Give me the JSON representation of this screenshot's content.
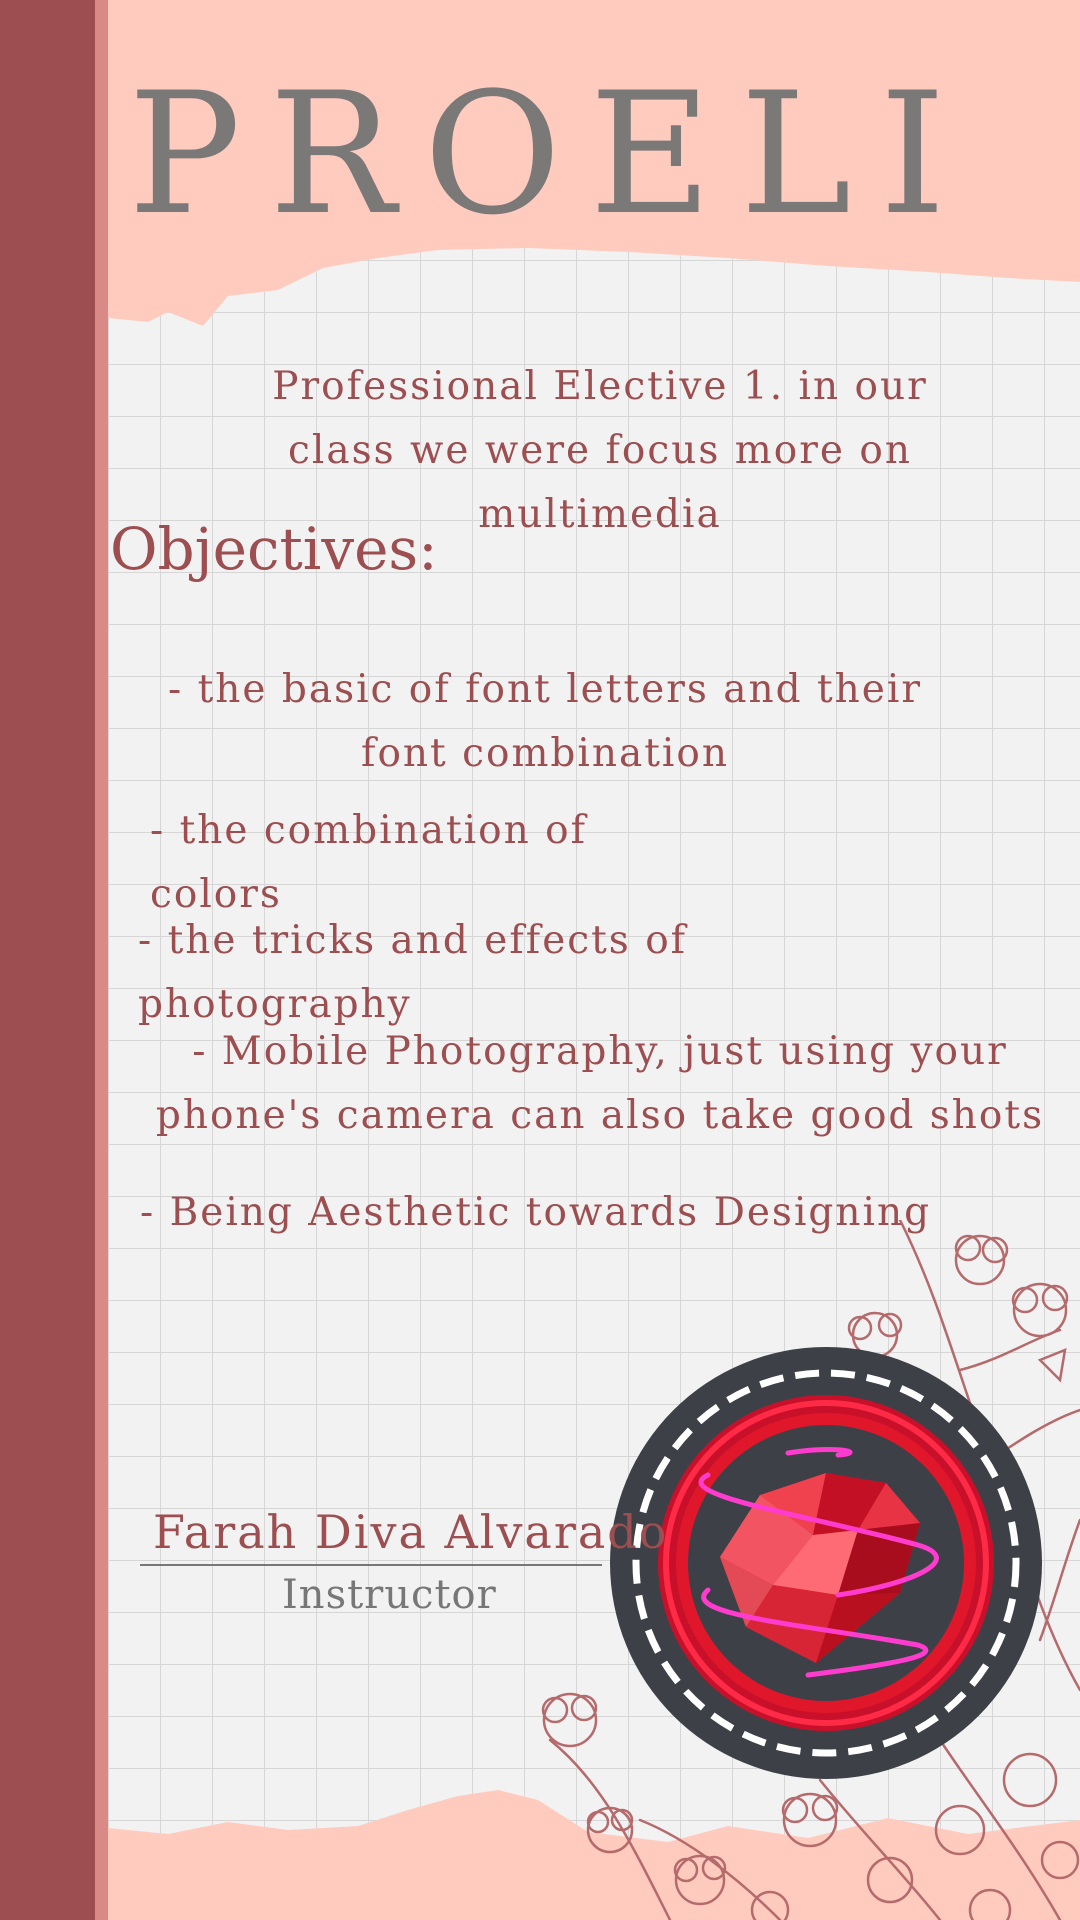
{
  "title": "PROELI",
  "description": "Professional Elective 1. in our class we were focus more on multimedia",
  "objectives": {
    "heading": "Objectives:",
    "items": [
      "- the basic of font letters and their font combination",
      "- the combination of colors",
      "- the tricks and effects of photography",
      "- Mobile Photography, just using your phone's camera can also take good shots",
      "- Being Aesthetic towards Designing"
    ]
  },
  "signature": {
    "name": "Farah Diva Alvarado",
    "role": "Instructor"
  },
  "colors": {
    "background": "#ffcbbf",
    "stripe_dark": "#9c4e50",
    "stripe_light": "#d98a86",
    "text_primary": "#9c4e50",
    "title": "#7b7878",
    "paper": "#f3f2f2",
    "grid": "#d6d6d6",
    "badge_dark": "#3e4048",
    "badge_red": "#e0162b",
    "badge_glow": "#ff3ccd"
  }
}
